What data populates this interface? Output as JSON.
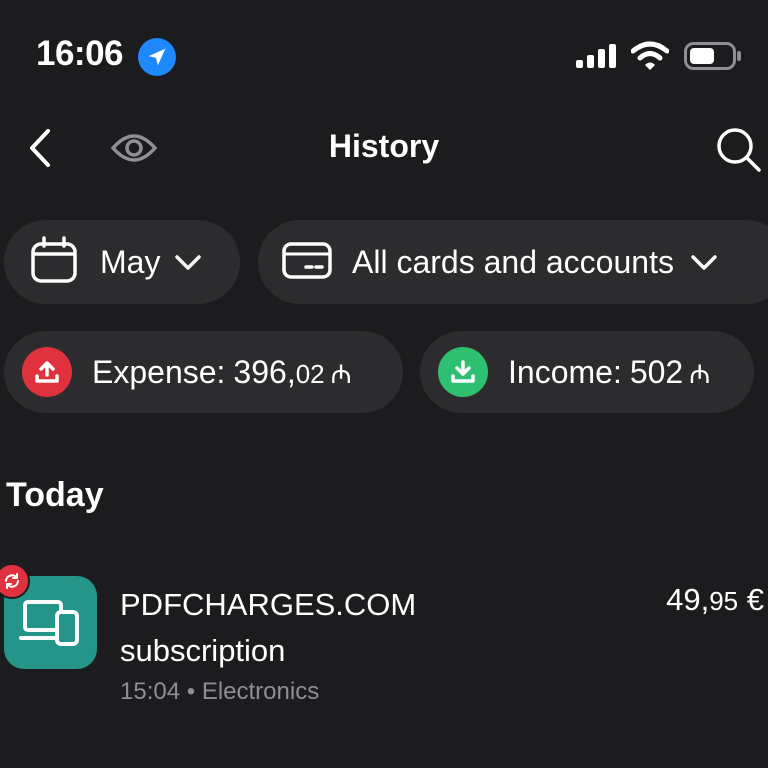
{
  "status_bar": {
    "time": "16:06"
  },
  "nav": {
    "title": "History"
  },
  "filters": {
    "month": "May",
    "cards": "All cards and accounts"
  },
  "summary": {
    "expense_label": "Expense:",
    "expense_int": "396,",
    "expense_dec": "02",
    "expense_currency": "₼",
    "income_label": "Income:",
    "income_value": "502",
    "income_currency": "₼"
  },
  "sections": [
    {
      "title": "Today",
      "transactions": [
        {
          "name": "PDFCHARGES.COM subscription",
          "time": "15:04",
          "separator": "•",
          "category": "Electronics",
          "amount_int": "49,",
          "amount_dec": "95",
          "currency": "€"
        }
      ]
    }
  ],
  "colors": {
    "background": "#1c1c1e",
    "chip": "#2c2c2e",
    "expense_red": "#e0323e",
    "income_green": "#2fbf71",
    "location_blue": "#1e88ff",
    "electronics_teal": "#25958a",
    "muted_text": "#8e8e93"
  }
}
